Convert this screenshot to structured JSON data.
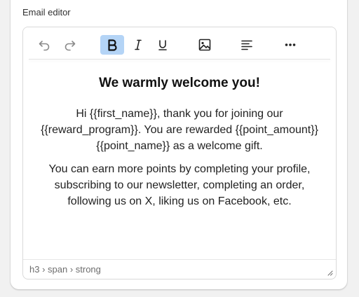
{
  "field": {
    "label": "Email editor"
  },
  "toolbar": {
    "buttons": [
      {
        "name": "undo-icon",
        "state": "disabled"
      },
      {
        "name": "redo-icon",
        "state": "disabled"
      },
      {
        "name": "bold-icon",
        "state": "active"
      },
      {
        "name": "italic-icon",
        "state": "normal"
      },
      {
        "name": "underline-icon",
        "state": "normal"
      },
      {
        "name": "image-icon",
        "state": "normal"
      },
      {
        "name": "align-left-icon",
        "state": "normal"
      },
      {
        "name": "more-icon",
        "state": "normal"
      }
    ]
  },
  "content": {
    "heading": "We warmly welcome you!",
    "paragraph1": "Hi {{first_name}}, thank you for joining our {{reward_program}}. You are rewarded {{point_amount}} {{point_name}} as a welcome gift.",
    "paragraph2": "You can earn more points by completing your profile, subscribing to our newsletter, completing an order, following us on X, liking us on Facebook, etc."
  },
  "statusbar": {
    "element_path": "h3 › span › strong"
  },
  "colors": {
    "active_button_bg": "#b4d4f6",
    "disabled_icon": "#8a8a8a",
    "icon": "#222222"
  }
}
